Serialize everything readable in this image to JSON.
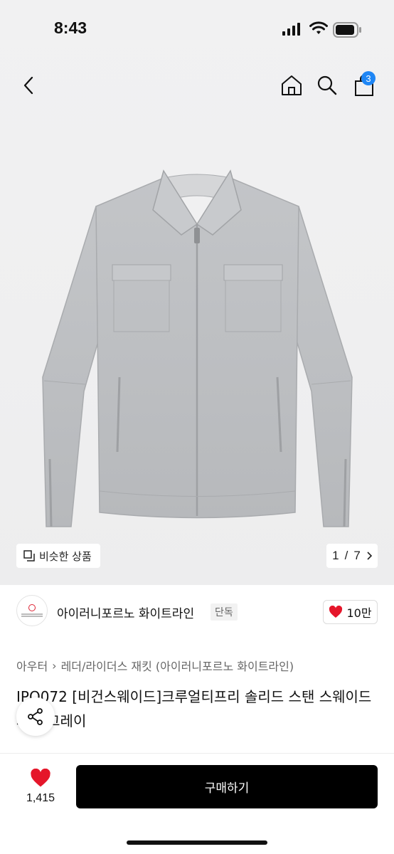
{
  "status_bar": {
    "time": "8:43"
  },
  "nav": {
    "cart_count": "3"
  },
  "gallery": {
    "similar_label": "비슷한 상품",
    "page_current": "1",
    "page_sep": "/",
    "page_total": "7"
  },
  "brand": {
    "name": "아이러니포르노 화이트라인",
    "tag": "단독",
    "likes": "10만"
  },
  "breadcrumb": {
    "category": "아우터",
    "separator": "›",
    "subcategory": "레더/라이더스 재킷 (아이러니포르노 화이트라인)"
  },
  "product": {
    "title": "IPO072 [비건스웨이드]크루얼티프리 솔리드 스탠 스웨이드 자켓 그레이"
  },
  "bottom_bar": {
    "wish_count": "1,415",
    "buy_label": "구매하기"
  },
  "colors": {
    "accent_badge": "#1f86f5",
    "heart": "#e5162a",
    "buy_bg": "#000000"
  },
  "icons": [
    "back-icon",
    "home-icon",
    "search-icon",
    "cart-icon",
    "similar-icon",
    "chevron-right-icon",
    "heart-icon",
    "share-icon"
  ]
}
